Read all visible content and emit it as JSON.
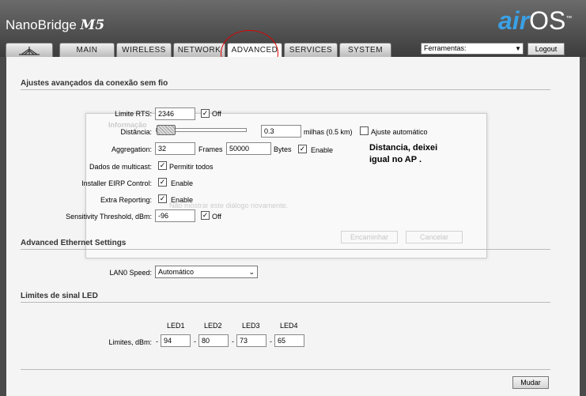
{
  "brand": {
    "name": "NanoBridge",
    "model": "M5",
    "os_prefix": "air",
    "os_suffix": "OS",
    "tm": "™"
  },
  "tabs": [
    {
      "label": ""
    },
    {
      "label": "MAIN"
    },
    {
      "label": "WIRELESS"
    },
    {
      "label": "NETWORK"
    },
    {
      "label": "ADVANCED"
    },
    {
      "label": "SERVICES"
    },
    {
      "label": "SYSTEM"
    }
  ],
  "header": {
    "tools_label": "Ferramentas:",
    "logout_label": "Logout"
  },
  "wireless_section": {
    "title": "Ajustes avançados da conexão sem fio",
    "rts_label": "Limite RTS:",
    "rts_value": "2346",
    "rts_off_label": "Off",
    "distance_label": "Distância:",
    "distance_value": "0.3",
    "distance_unit": "milhas (0.5 km)",
    "auto_adjust_label": "Ajuste automático",
    "aggregation_label": "Aggregation:",
    "aggregation_frames": "32",
    "frames_label": "Frames",
    "aggregation_bytes": "50000",
    "bytes_label": "Bytes",
    "enable_label": "Enable",
    "multicast_label": "Dados de multicast:",
    "multicast_option": "Permitir todos",
    "eirp_label": "Installer EIRP Control:",
    "eirp_option": "Enable",
    "extra_label": "Extra Reporting:",
    "extra_option": "Enable",
    "sensitivity_label": "Sensitivity Threshold, dBm:",
    "sensitivity_value": "-96",
    "sensitivity_off_label": "Off"
  },
  "note": "Distancia, deixei igual no AP .",
  "ghost_dialog": {
    "title": "Informação",
    "message": "Não mostrar este diálogo novamente.",
    "forward_label": "Encaminhar",
    "cancel_label": "Cancelar"
  },
  "ethernet_section": {
    "title": "Advanced Ethernet Settings",
    "lan_label": "LAN0 Speed:",
    "lan_value": "Automático"
  },
  "led_section": {
    "title": "Limites de sinal LED",
    "limits_label": "Limites, dBm:",
    "leds": [
      {
        "name": "LED1",
        "value": "94"
      },
      {
        "name": "LED2",
        "value": "80"
      },
      {
        "name": "LED3",
        "value": "73"
      },
      {
        "name": "LED4",
        "value": "65"
      }
    ]
  },
  "change_button_label": "Mudar"
}
